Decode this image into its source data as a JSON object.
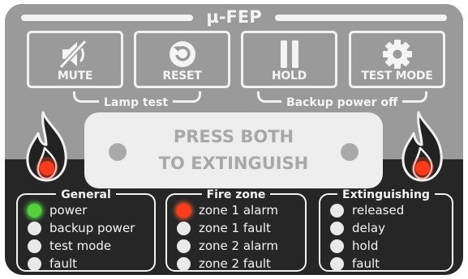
{
  "title": "µ-FEP",
  "buttons": [
    {
      "label": "MUTE",
      "icon": "speaker-muted-icon"
    },
    {
      "label": "RESET",
      "icon": "reset-icon"
    },
    {
      "label": "HOLD",
      "icon": "pause-icon"
    },
    {
      "label": "TEST MODE",
      "icon": "gear-icon"
    }
  ],
  "brackets": {
    "lamp_test": "Lamp test",
    "backup_power_off": "Backup power off"
  },
  "extinguish": {
    "line1": "PRESS BOTH",
    "line2": "TO EXTINGUISH"
  },
  "flames": {
    "left_icon": "flame-icon",
    "right_icon": "flame-icon",
    "led_color": "#ff3b1e"
  },
  "groups": [
    {
      "title": "General",
      "items": [
        {
          "label": "power",
          "state": "green"
        },
        {
          "label": "backup power",
          "state": "off"
        },
        {
          "label": "test mode",
          "state": "off"
        },
        {
          "label": "fault",
          "state": "off"
        }
      ]
    },
    {
      "title": "Fire zone",
      "items": [
        {
          "label": "zone 1 alarm",
          "state": "red"
        },
        {
          "label": "zone 1 fault",
          "state": "off"
        },
        {
          "label": "zone 2 alarm",
          "state": "off"
        },
        {
          "label": "zone 2 fault",
          "state": "off"
        }
      ]
    },
    {
      "title": "Extinguishing",
      "items": [
        {
          "label": "released",
          "state": "off"
        },
        {
          "label": "delay",
          "state": "off"
        },
        {
          "label": "hold",
          "state": "off"
        },
        {
          "label": "fault",
          "state": "off"
        }
      ]
    }
  ],
  "colors": {
    "panel_dark": "#262626",
    "panel_grey": "#9a9a9a",
    "led_green": "#57d13a",
    "led_red": "#ff3b1e",
    "led_off": "#e9e9e9"
  }
}
